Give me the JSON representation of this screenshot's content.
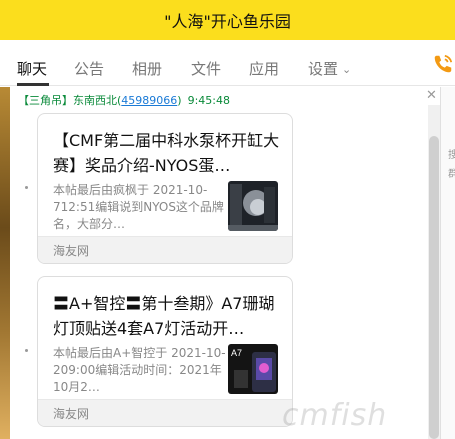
{
  "window": {
    "title": "\"人海\"开心鱼乐园"
  },
  "tabs": [
    {
      "label": "聊天"
    },
    {
      "label": "公告"
    },
    {
      "label": "相册"
    },
    {
      "label": "文件"
    },
    {
      "label": "应用"
    },
    {
      "label": "设置"
    }
  ],
  "chat": {
    "sender": {
      "tag": "【三角吊】东南西北",
      "qq": "45989066",
      "time": "9:45:48"
    },
    "cards": [
      {
        "title": "【CMF第二届中科水泵杯开缸大赛】奖品介绍-NYOS蛋…",
        "desc": "本帖最后由疯枫于 2021-10-712:51编辑说到NYOS这个品牌名，大部分…",
        "source": "海友网"
      },
      {
        "title": "〓A+智控〓第十叁期》A7珊瑚灯顶贴送4套A7灯活动开…",
        "desc": "本帖最后由A+智控于 2021-10-209:00编辑活动时间：2021年10月2…",
        "source": "海友网",
        "thumb_text": "A7"
      }
    ]
  },
  "right_panel": {
    "chars": [
      "搜",
      "群"
    ]
  },
  "watermark": "cmfish",
  "colors": {
    "titlebar": "#fbde1d",
    "sender_green": "#0a8a3a",
    "link_blue": "#1a7ad6",
    "phone_orange": "#f39a13"
  },
  "icons": {
    "phone": "phone-icon",
    "close": "close-icon",
    "dropdown": "chevron-down-icon"
  }
}
